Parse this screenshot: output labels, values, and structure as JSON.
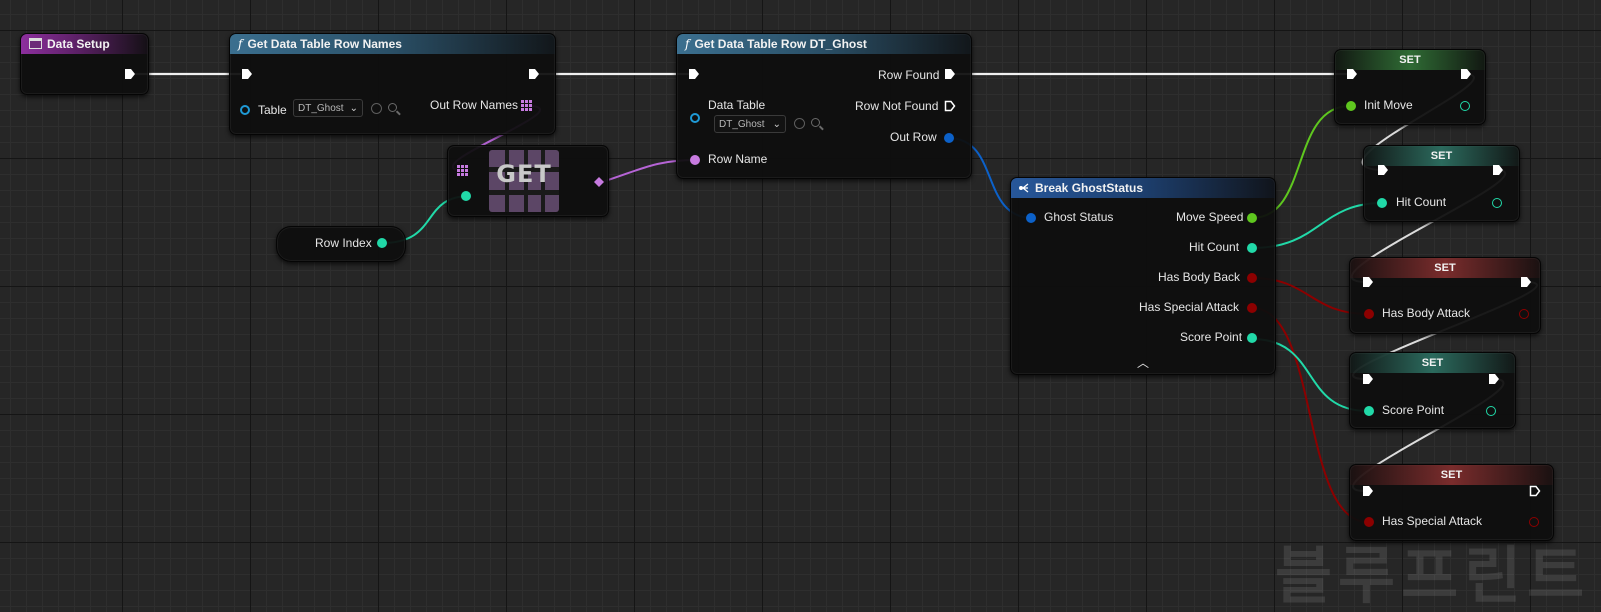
{
  "nodes": {
    "data_setup": {
      "title": "Data Setup"
    },
    "get_row_names": {
      "title": "Get Data Table Row Names",
      "table_label": "Table",
      "table_value": "DT_Ghost",
      "out_label": "Out Row Names"
    },
    "get_array": {
      "label": "GET"
    },
    "row_index": {
      "label": "Row Index"
    },
    "get_row": {
      "title": "Get Data Table Row DT_Ghost",
      "row_found": "Row Found",
      "row_not_found": "Row Not Found",
      "data_table_label": "Data Table",
      "data_table_value": "DT_Ghost",
      "out_row": "Out Row",
      "row_name": "Row Name"
    },
    "break": {
      "title": "Break GhostStatus",
      "input": "Ghost Status",
      "outputs": [
        "Move Speed",
        "Hit Count",
        "Has Body Back",
        "Has Special Attack",
        "Score Point"
      ]
    },
    "set_nodes": [
      {
        "title": "SET",
        "var": "Init Move"
      },
      {
        "title": "SET",
        "var": "Hit Count"
      },
      {
        "title": "SET",
        "var": "Has Body Attack"
      },
      {
        "title": "SET",
        "var": "Score Point"
      },
      {
        "title": "SET",
        "var": "Has Special Attack"
      }
    ]
  },
  "colors": {
    "exec": "#ffffff",
    "float": "#a3e01f",
    "integer": "#21d9a8",
    "boolean": "#8c0000",
    "name": "#c77be0",
    "struct": "#0c61c9",
    "datatable": "#1f9ad6"
  },
  "watermark": "블루프린트"
}
